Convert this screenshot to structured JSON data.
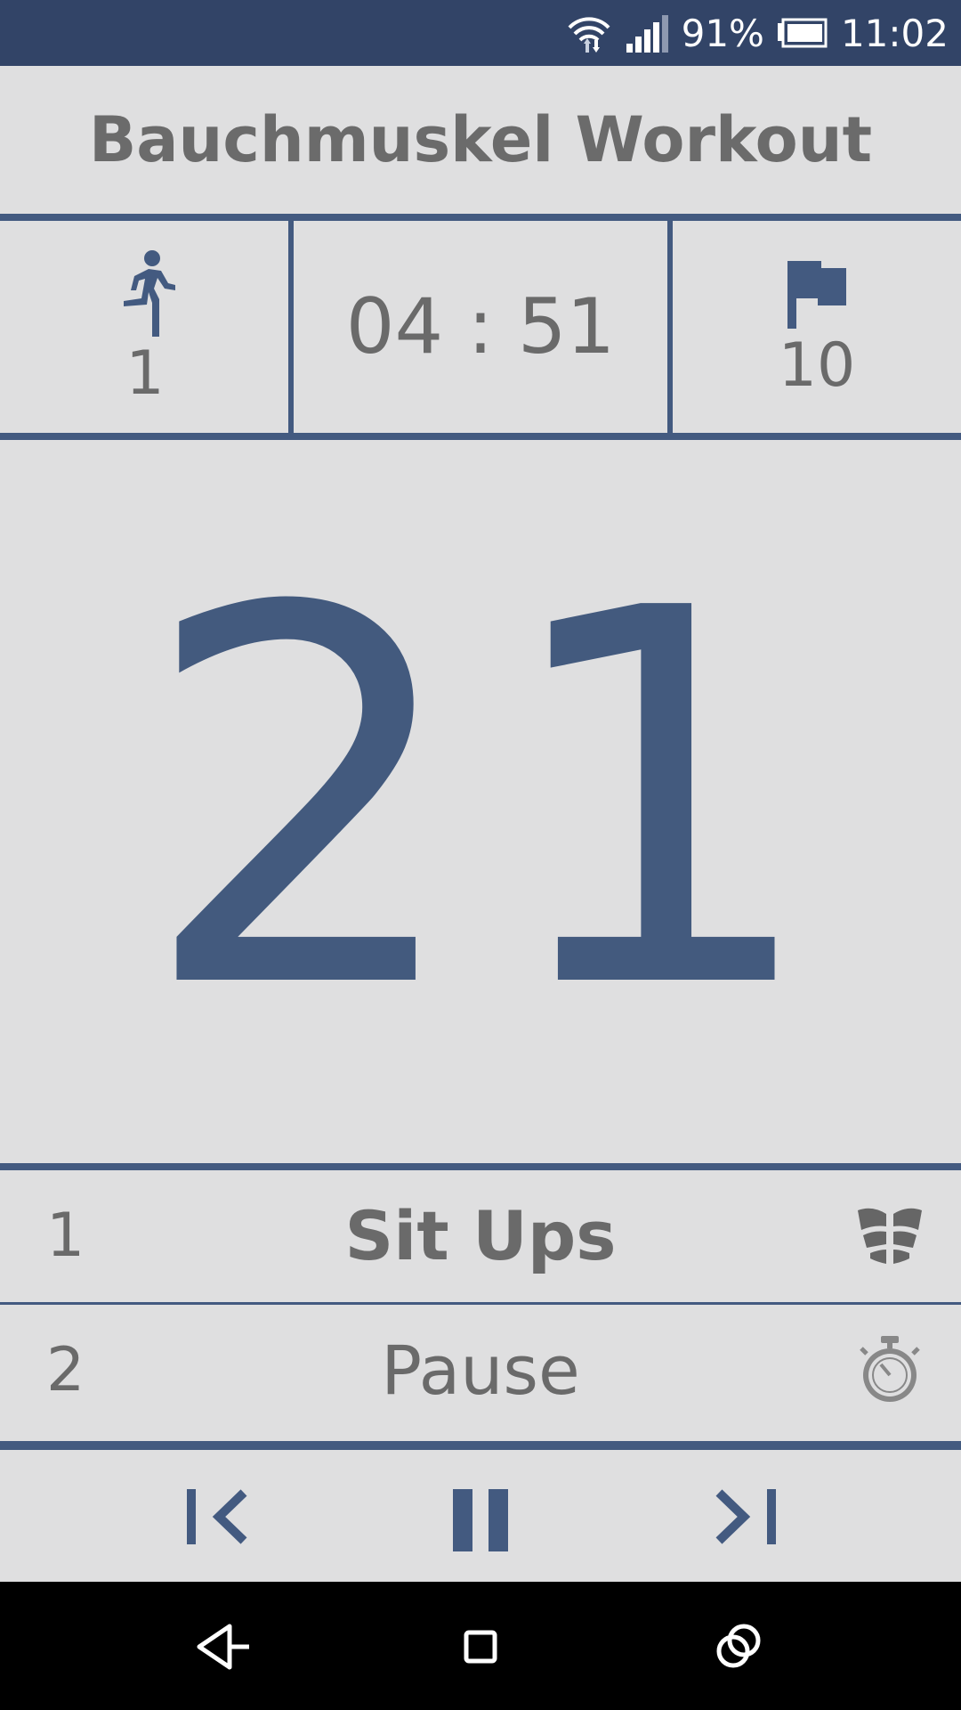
{
  "status_bar": {
    "battery_percent": "91%",
    "time": "11:02",
    "icons": [
      "wifi-icon",
      "signal-icon",
      "battery-icon"
    ]
  },
  "header": {
    "title": "Bauchmuskel Workout"
  },
  "stats": {
    "round": {
      "icon": "running-person-icon",
      "value": "1"
    },
    "timer": "04 : 51",
    "goal": {
      "icon": "flag-icon",
      "value": "10"
    }
  },
  "counter": "21",
  "exercises": [
    {
      "number": "1",
      "name": "Sit Ups",
      "icon": "abs-muscle-icon"
    },
    {
      "number": "2",
      "name": "Pause",
      "icon": "stopwatch-icon"
    }
  ],
  "controls": [
    "previous-icon",
    "pause-icon",
    "next-icon"
  ],
  "nav": [
    "back-icon",
    "home-icon",
    "recents-icon"
  ],
  "colors": {
    "accent": "#435a80",
    "status_bar": "#324467",
    "background": "#dfdfe0",
    "text": "#6a6a6a"
  }
}
